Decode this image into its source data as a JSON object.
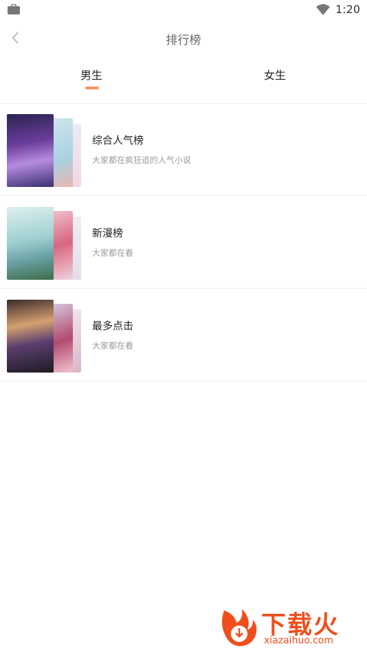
{
  "status": {
    "time": "1:20"
  },
  "header": {
    "title": "排行榜"
  },
  "tabs": [
    {
      "label": "男生",
      "active": true
    },
    {
      "label": "女生",
      "active": false
    }
  ],
  "ranks": [
    {
      "title": "综合人气榜",
      "desc": "大家都在疯狂追的人气小说"
    },
    {
      "title": "新漫榜",
      "desc": "大家都在看"
    },
    {
      "title": "最多点击",
      "desc": "大家都在看"
    }
  ],
  "watermark": {
    "text": "下载火",
    "sub": "xiazaihuo.com"
  },
  "colors": {
    "accent": "#f7925d",
    "brand": "#ef4f1d"
  }
}
